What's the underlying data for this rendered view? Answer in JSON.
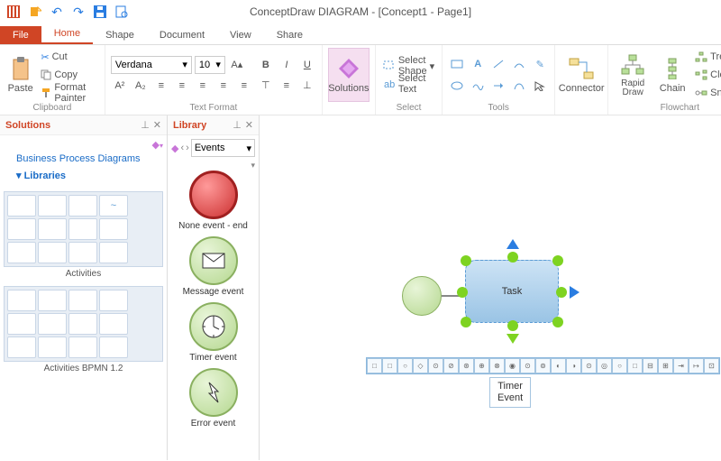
{
  "app_title": "ConceptDraw DIAGRAM - [Concept1 - Page1]",
  "tabs": {
    "file": "File",
    "home": "Home",
    "shape": "Shape",
    "document": "Document",
    "view": "View",
    "share": "Share"
  },
  "ribbon": {
    "clipboard": {
      "paste": "Paste",
      "cut": "Cut",
      "copy": "Copy",
      "fmt": "Format Painter",
      "label": "Clipboard"
    },
    "textformat": {
      "font": "Verdana",
      "size": "10",
      "label": "Text Format"
    },
    "solutions": {
      "btn": "Solutions"
    },
    "select": {
      "shape": "Select Shape",
      "text": "Select Text",
      "label": "Select"
    },
    "tools": {
      "label": "Tools"
    },
    "connector": {
      "btn": "Connector"
    },
    "flowchart": {
      "rapid": "Rapid Draw",
      "chain": "Chain",
      "tree": "Tree",
      "clone": "Clone",
      "snap": "Snap",
      "label": "Flowchart"
    }
  },
  "panels": {
    "solutions": {
      "title": "Solutions",
      "items": [
        "Business Process Diagrams",
        "Libraries"
      ],
      "thumbs": [
        "Activities",
        "Activities BPMN 1.2"
      ]
    },
    "library": {
      "title": "Library",
      "picker": "Events",
      "shapes": [
        "None event - end",
        "Message event",
        "Timer event",
        "Error event"
      ]
    }
  },
  "canvas": {
    "task_label": "Task",
    "tooltip": "Timer\nEvent"
  }
}
